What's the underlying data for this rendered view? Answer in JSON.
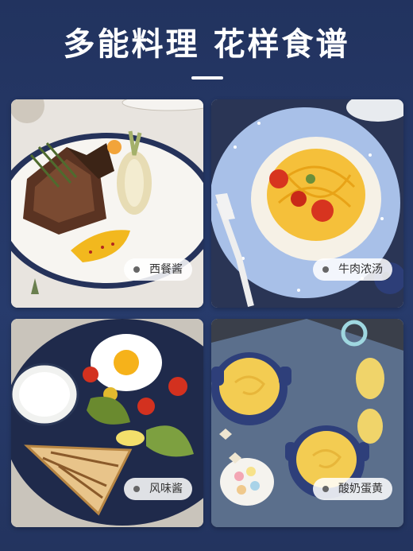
{
  "header": {
    "title": "多能料理 花样食谱"
  },
  "cards": [
    {
      "label": "西餐酱"
    },
    {
      "label": "牛肉浓汤"
    },
    {
      "label": "风味酱"
    },
    {
      "label": "酸奶蛋黄"
    }
  ],
  "colors": {
    "background": "#233564",
    "title": "#ffffff",
    "pill_background": "#f2f2f2",
    "sauce_yellow": "#f2c94c"
  }
}
